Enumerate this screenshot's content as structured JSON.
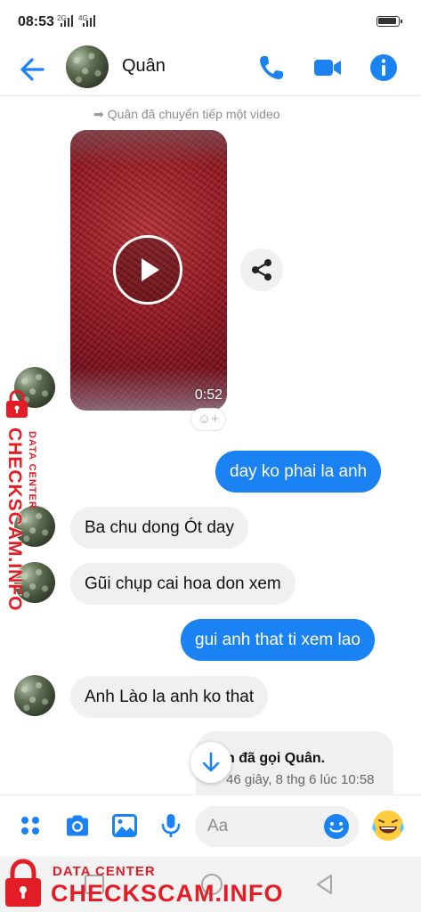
{
  "status_bar": {
    "time": "08:53",
    "net1": "2G",
    "net2": "4G"
  },
  "header": {
    "contact_name": "Quân",
    "icons": [
      "back-arrow-icon",
      "phone-icon",
      "video-camera-icon",
      "info-icon"
    ]
  },
  "chat": {
    "forward_note": "Quân đã chuyển tiếp một video",
    "video": {
      "duration": "0:52"
    },
    "messages": [
      {
        "direction": "out",
        "text": "day ko phai la anh"
      },
      {
        "direction": "in",
        "text": "Ba chu dong Ót day"
      },
      {
        "direction": "in",
        "text": "Gũi chụp cai hoa don xem"
      },
      {
        "direction": "out",
        "text": "gui anh that ti xem lao"
      },
      {
        "direction": "in",
        "text": "Anh Lào la anh ko that"
      }
    ],
    "call_card": {
      "title": "n đã gọi Quân.",
      "subtitle": "46 giây, 8 thg 6 lúc 10:58"
    }
  },
  "composer": {
    "placeholder": "Aa",
    "icons": [
      "menu-dots-icon",
      "camera-icon",
      "image-icon",
      "microphone-icon",
      "emoji-icon",
      "laughing-emoji-icon"
    ]
  },
  "watermark": {
    "label_small": "DATA CENTER",
    "label_big": "CHECKSCAM.INFO"
  },
  "colors": {
    "accent": "#1a82f3",
    "incoming_bubble": "#f0f0f0",
    "watermark_red": "#e31d26"
  }
}
